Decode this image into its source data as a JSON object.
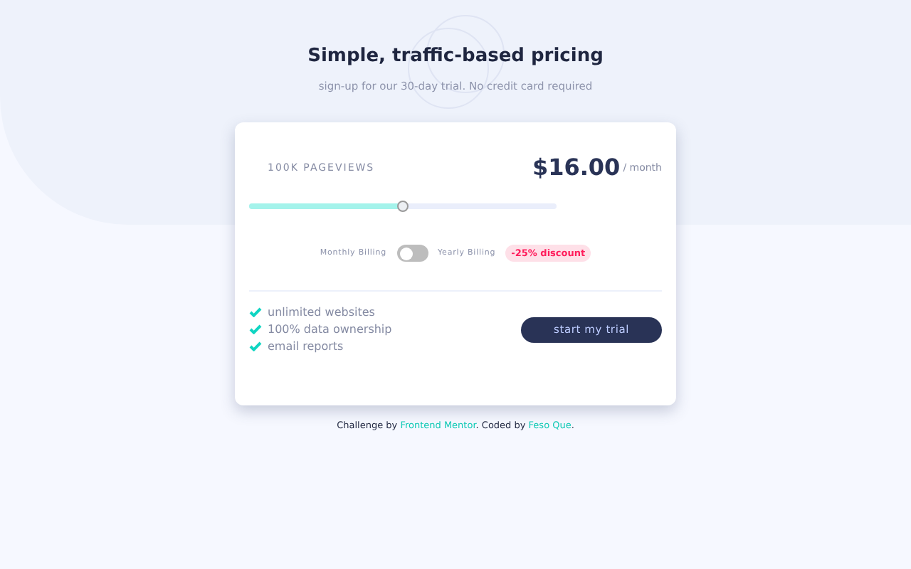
{
  "header": {
    "title": "Simple, traffic-based pricing",
    "subtitle": "sign-up for our 30-day trial. No credit card required"
  },
  "card": {
    "pageviews": "100K PAGEVIEWS",
    "price": "$16.00",
    "period": "/ month",
    "slider": {
      "level": 0.5
    },
    "billing": {
      "monthly_label": "Monthly Billing",
      "yearly_label": "Yearly Billing",
      "yearly": false,
      "discount": "-25% discount"
    },
    "features": [
      "unlimited websites",
      "100% data ownership",
      "email reports"
    ],
    "button": "start my trial"
  },
  "footer": {
    "prefix": "Challenge by ",
    "link_1": "Frontend Mentor",
    "middle": ". Coded by ",
    "link_2": "Feso Que",
    "suffix": "."
  }
}
